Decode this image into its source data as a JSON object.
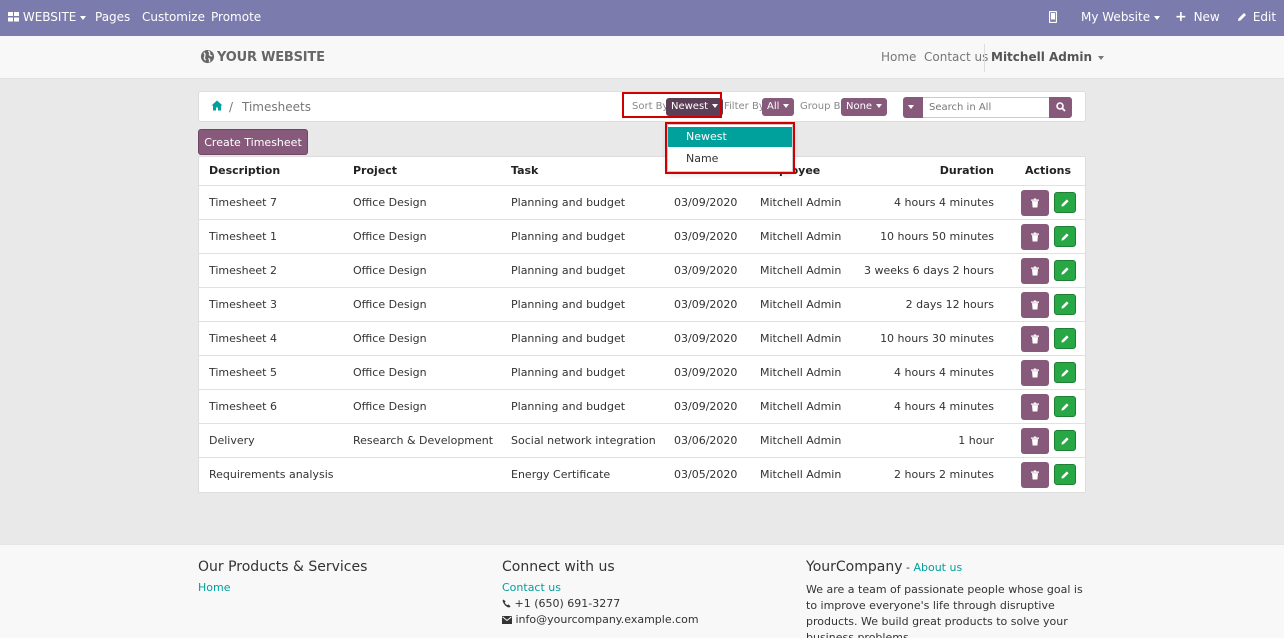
{
  "topbar": {
    "app_menu": "WEBSITE",
    "pages": "Pages",
    "customize": "Customize",
    "promote": "Promote",
    "site_switch": "My Website",
    "new": "New",
    "edit": "Edit",
    "background": "#7c7bad"
  },
  "header": {
    "logo": "YOUR WEBSITE",
    "nav": {
      "home": "Home",
      "contact": "Contact us",
      "user": "Mitchell Admin"
    }
  },
  "breadcrumb": {
    "current": "Timesheets",
    "separator": "/"
  },
  "controls": {
    "sort_label": "Sort By:",
    "sort_value": "Newest",
    "filter_label": "Filter By:",
    "filter_value": "All",
    "group_label": "Group By:",
    "group_value": "None",
    "search_placeholder": "Search in All"
  },
  "sort_dropdown": {
    "options": [
      "Newest",
      "Name"
    ],
    "selected": "Newest"
  },
  "create_button": "Create Timesheet",
  "table": {
    "headers": {
      "description": "Description",
      "project": "Project",
      "task": "Task",
      "employee": "Employee",
      "duration": "Duration",
      "actions": "Actions"
    },
    "rows": [
      {
        "description": "Timesheet 7",
        "project": "Office Design",
        "task": "Planning and budget",
        "date": "03/09/2020",
        "employee": "Mitchell Admin",
        "duration": "4 hours 4 minutes"
      },
      {
        "description": "Timesheet 1",
        "project": "Office Design",
        "task": "Planning and budget",
        "date": "03/09/2020",
        "employee": "Mitchell Admin",
        "duration": "10 hours 50 minutes"
      },
      {
        "description": "Timesheet 2",
        "project": "Office Design",
        "task": "Planning and budget",
        "date": "03/09/2020",
        "employee": "Mitchell Admin",
        "duration": "3 weeks 6 days 2 hours"
      },
      {
        "description": "Timesheet 3",
        "project": "Office Design",
        "task": "Planning and budget",
        "date": "03/09/2020",
        "employee": "Mitchell Admin",
        "duration": "2 days 12 hours"
      },
      {
        "description": "Timesheet 4",
        "project": "Office Design",
        "task": "Planning and budget",
        "date": "03/09/2020",
        "employee": "Mitchell Admin",
        "duration": "10 hours 30 minutes"
      },
      {
        "description": "Timesheet 5",
        "project": "Office Design",
        "task": "Planning and budget",
        "date": "03/09/2020",
        "employee": "Mitchell Admin",
        "duration": "4 hours 4 minutes"
      },
      {
        "description": "Timesheet 6",
        "project": "Office Design",
        "task": "Planning and budget",
        "date": "03/09/2020",
        "employee": "Mitchell Admin",
        "duration": "4 hours 4 minutes"
      },
      {
        "description": "Delivery",
        "project": "Research & Development",
        "task": "Social network integration",
        "date": "03/06/2020",
        "employee": "Mitchell Admin",
        "duration": "1 hour"
      },
      {
        "description": "Requirements analysis",
        "project": "",
        "task": "Energy Certificate",
        "date": "03/05/2020",
        "employee": "Mitchell Admin",
        "duration": "2 hours 2 minutes"
      }
    ]
  },
  "footer": {
    "col1_title": "Our Products & Services",
    "col1_link": "Home",
    "col2_title": "Connect with us",
    "col2_link": "Contact us",
    "phone": "+1 (650) 691-3277",
    "email": "info@yourcompany.example.com",
    "col3_title": "YourCompany",
    "col3_dash": " - ",
    "col3_link": "About us",
    "about_text": "We are a team of passionate people whose goal is to improve everyone's life through disruptive products. We build great products to solve your business problems."
  }
}
